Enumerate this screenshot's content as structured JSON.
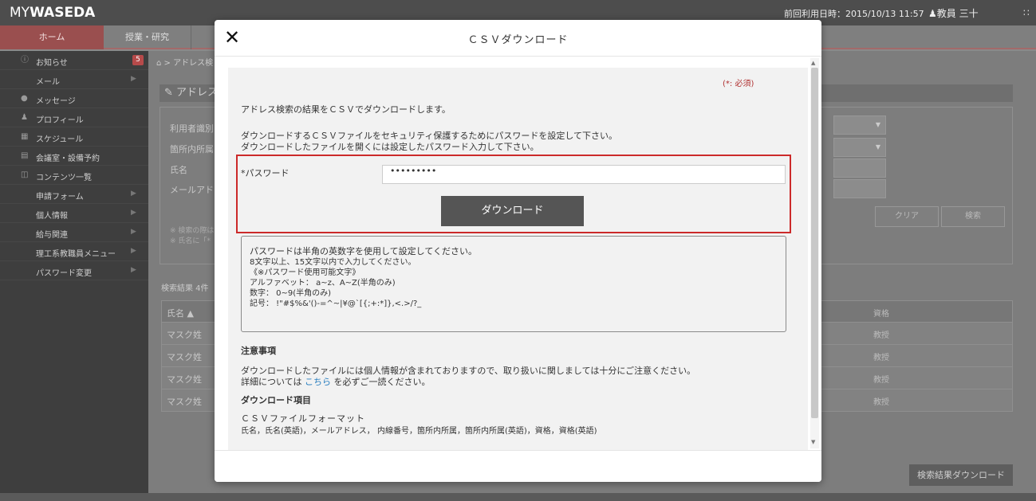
{
  "header": {
    "logo_my": "MY",
    "logo_waseda": "WASEDA",
    "last_login": "前回利用日時：2015/10/13 11:57",
    "user": "教員 三十"
  },
  "nav": {
    "home": "ホーム",
    "classes": "授業・研究"
  },
  "sidebar": {
    "items": [
      {
        "label": "お知らせ",
        "icon": "info-icon",
        "badge": "5"
      },
      {
        "label": "メール",
        "arrow": "▶"
      },
      {
        "label": "メッセージ",
        "icon": "chat-icon"
      },
      {
        "label": "プロフィール",
        "icon": "person-icon"
      },
      {
        "label": "スケジュール",
        "icon": "calendar-icon"
      },
      {
        "label": "会議室・設備予約",
        "icon": "room-icon"
      },
      {
        "label": "コンテンツ一覧",
        "icon": "contents-icon"
      },
      {
        "label": "申請フォーム",
        "arrow": "▶"
      },
      {
        "label": "個人情報",
        "arrow": "▶"
      },
      {
        "label": "給与関連",
        "arrow": "▶"
      },
      {
        "label": "理工系教職員メニュー",
        "arrow": "▶"
      },
      {
        "label": "パスワード変更",
        "arrow": "▶"
      }
    ]
  },
  "background": {
    "breadcrumb": "> アドレス検",
    "section_title": "アドレス",
    "labels": [
      "利用者識別",
      "箇所内所属",
      "氏名",
      "メールアド"
    ],
    "notes": [
      "※ 検索の際は",
      "※ 氏名に「*"
    ],
    "clear_button": "クリア",
    "search_button": "検索",
    "result_count": "検索結果 4件",
    "table_headers": {
      "name": "氏名 ▲",
      "qualification": "資格"
    },
    "rows": [
      {
        "name": "マスク姓",
        "qualification": "教授"
      },
      {
        "name": "マスク姓",
        "qualification": "教授"
      },
      {
        "name": "マスク姓",
        "qualification": "教授"
      },
      {
        "name": "マスク姓",
        "qualification": "教授"
      }
    ],
    "download_results_button": "検索結果ダウンロード"
  },
  "modal": {
    "close": "✕",
    "title": "ＣＳＶダウンロード",
    "required_note": "(*: 必須)",
    "intro": "アドレス検索の結果をＣＳＶでダウンロードします。",
    "pw_info_1": "ダウンロードするＣＳＶファイルをセキュリティ保護するためにパスワードを設定して下さい。",
    "pw_info_2": "ダウンロードしたファイルを開くには設定したパスワード入力して下さい。",
    "password_label": "*パスワード",
    "password_value": "•••••••••",
    "download_button": "ダウンロード",
    "rules": [
      "パスワードは半角の英数字を使用して設定してください。",
      "8文字以上、15文字以内で入力してください。",
      "《※パスワード使用可能文字》",
      "アルファベット： a~z、A~Z(半角のみ)",
      "数字： 0~9(半角のみ)",
      "記号： !\"#$%&'()-=^~|¥@`[{;+:*]},<.>/?_"
    ],
    "notice_heading": "注意事項",
    "notice_1": "ダウンロードしたファイルには個人情報が含まれておりますので、取り扱いに関しましては十分にご注意ください。",
    "notice_2_prefix": "詳細については",
    "notice_2_link": "こちら",
    "notice_2_suffix": "を必ずご一読ください。",
    "items_heading": "ダウンロード項目",
    "format_title": "ＣＳＶファイルフォーマット",
    "format_list": "氏名，氏名(英語)，メールアドレス， 内線番号，箇所内所属，箇所内所属(英語)，資格，資格(英語)"
  }
}
